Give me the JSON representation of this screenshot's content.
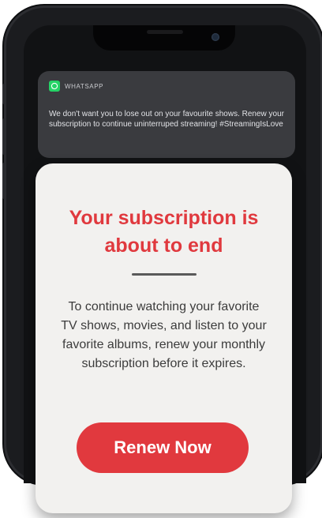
{
  "notification": {
    "app_name": "WHATSAPP",
    "app_icon": "whatsapp-icon",
    "message": "We don't want you to lose out on your favourite shows. Renew your subscription to continue uninterruped streaming! #StreamingIsLove"
  },
  "modal": {
    "title": "Your subscription is\nabout to end",
    "body": "To continue watching your favorite TV shows, movies, and listen to your favorite albums, renew your monthly subscription before it expires.",
    "button_label": "Renew Now"
  },
  "colors": {
    "accent": "#e1393e",
    "notification_bg": "#3a3b3f",
    "card_bg": "#f2f1ef",
    "whatsapp_green": "#25d366"
  }
}
